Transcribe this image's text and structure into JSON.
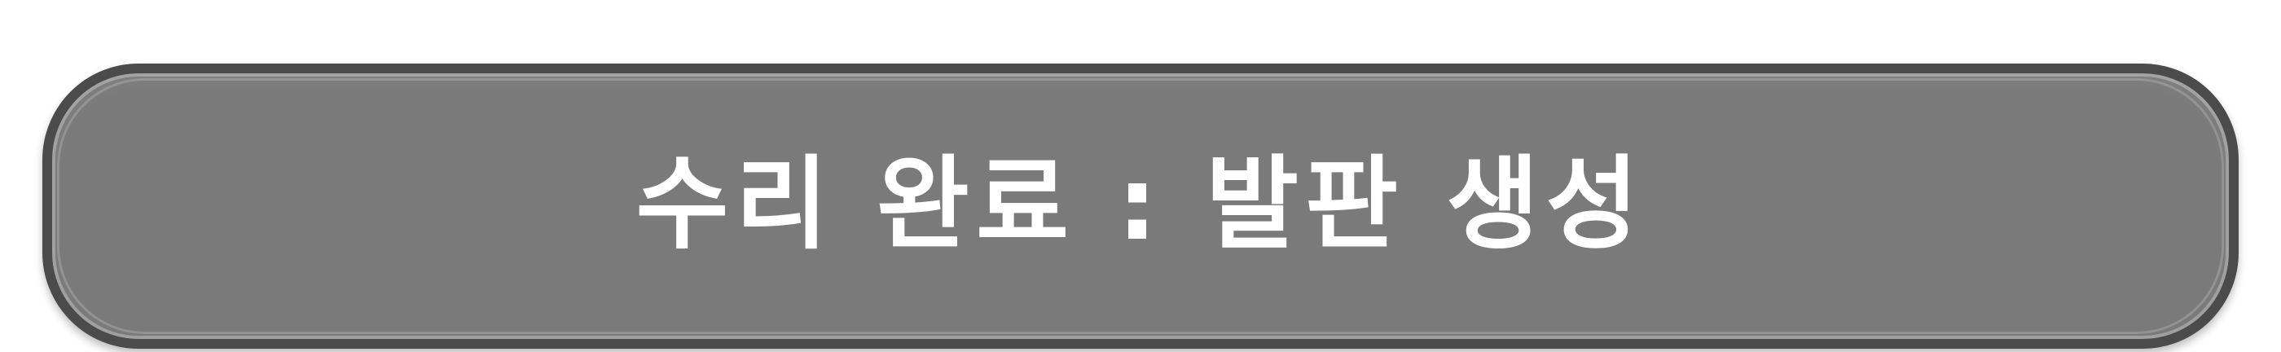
{
  "button": {
    "label": "수리 완료 : 발판 생성"
  },
  "colors": {
    "button_fill": "#7a7a7a",
    "button_border": "#4b4b4b",
    "label": "#ffffff",
    "background": "#ffffff"
  }
}
